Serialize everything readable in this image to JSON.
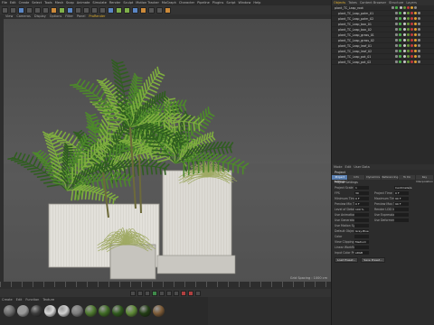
{
  "menubar": [
    "File",
    "Edit",
    "Create",
    "Select",
    "Tools",
    "Mesh",
    "Snap",
    "Animate",
    "Simulate",
    "Render",
    "Sculpt",
    "Motion Tracker",
    "MoGraph",
    "Character",
    "Pipeline",
    "Plugins",
    "Script",
    "Window",
    "Help"
  ],
  "viewport": {
    "tabs": [
      "View",
      "Cameras",
      "Display",
      "Options",
      "Filter",
      "Panel",
      "ProRender"
    ],
    "active_tab_index": 6,
    "grid_info": "Grid Spacing : 1000 cm"
  },
  "object_manager": {
    "tabs": [
      "Objects",
      "Takes",
      "Content Browser",
      "Structure",
      "Layers"
    ],
    "active_tab_index": 0,
    "objects": [
      "plant_TC_Lasp_root",
      "plant_TC_Lasp_palm_01",
      "plant_TC_Lasp_palm_02",
      "plant_TC_Lasp_box_01",
      "plant_TC_Lasp_box_02",
      "plant_TC_Lasp_grass_01",
      "plant_TC_Lasp_grass_02",
      "plant_TC_Lasp_leaf_01",
      "plant_TC_Lasp_leaf_02",
      "plant_TC_Lasp_pot_01",
      "plant_TC_Lasp_pot_02"
    ]
  },
  "attribute_manager": {
    "menu": [
      "Mode",
      "Edit",
      "User Data"
    ],
    "title": "Project",
    "tabs": [
      "Project Settings",
      "Info",
      "Dynamics",
      "Referencing",
      "To Do",
      "Key Interpolation"
    ],
    "active_tab_index": 0,
    "section": "Project Settings",
    "rows": [
      {
        "l1": "Project Scale",
        "v1": "1",
        "l2": "",
        "v2": "Centimeters"
      },
      {
        "l1": "FPS",
        "v1": "30",
        "l2": "Project Time",
        "v2": "0 F"
      },
      {
        "l1": "Minimum Time",
        "v1": "0 F",
        "l2": "Maximum Time",
        "v2": "90 F"
      },
      {
        "l1": "Preview Min Time",
        "v1": "0 F",
        "l2": "Preview Max Time",
        "v2": "90 F"
      },
      {
        "l1": "Level of Detail",
        "v1": "100 %",
        "l2": "Render LOD in Editor",
        "v2": ""
      },
      {
        "l1": "Use Animation",
        "v1": "",
        "l2": "Use Expression",
        "v2": ""
      },
      {
        "l1": "Use Generators",
        "v1": "",
        "l2": "Use Deformers",
        "v2": ""
      },
      {
        "l1": "Use Motion System",
        "v1": "",
        "l2": "",
        "v2": ""
      },
      {
        "l1": "Default Object Color",
        "v1": "Gray-Blue",
        "l2": "",
        "v2": ""
      },
      {
        "l1": "Color",
        "v1": "",
        "l2": "",
        "v2": ""
      },
      {
        "l1": "View Clipping",
        "v1": "Medium",
        "l2": "",
        "v2": ""
      },
      {
        "l1": "Linear Workflow",
        "v1": "",
        "l2": "",
        "v2": ""
      },
      {
        "l1": "Input Color Profile",
        "v1": "sRGB",
        "l2": "",
        "v2": ""
      }
    ],
    "buttons": [
      "Load Preset...",
      "Save Preset..."
    ]
  },
  "materials": {
    "menu": [
      "Create",
      "Edit",
      "Function",
      "Texture"
    ],
    "swatch_colors": [
      "#6b6b6b",
      "#9a9a9a",
      "#3b3b3b",
      "#d8d8d8",
      "#cfcfcf",
      "#7d7d7d",
      "#4e7a2e",
      "#3f6b24",
      "#2f5a1c",
      "#5e8a36",
      "#223d14",
      "#7c5a36"
    ]
  },
  "colors": {
    "accent": "#e0b030",
    "selection": "#5a7fb0",
    "leaf_dark": "#2f5e1f",
    "leaf_mid": "#4d8a2a",
    "leaf_light": "#7fae3f",
    "grass": "#9aa65a",
    "planter": "#d9d6cf"
  }
}
